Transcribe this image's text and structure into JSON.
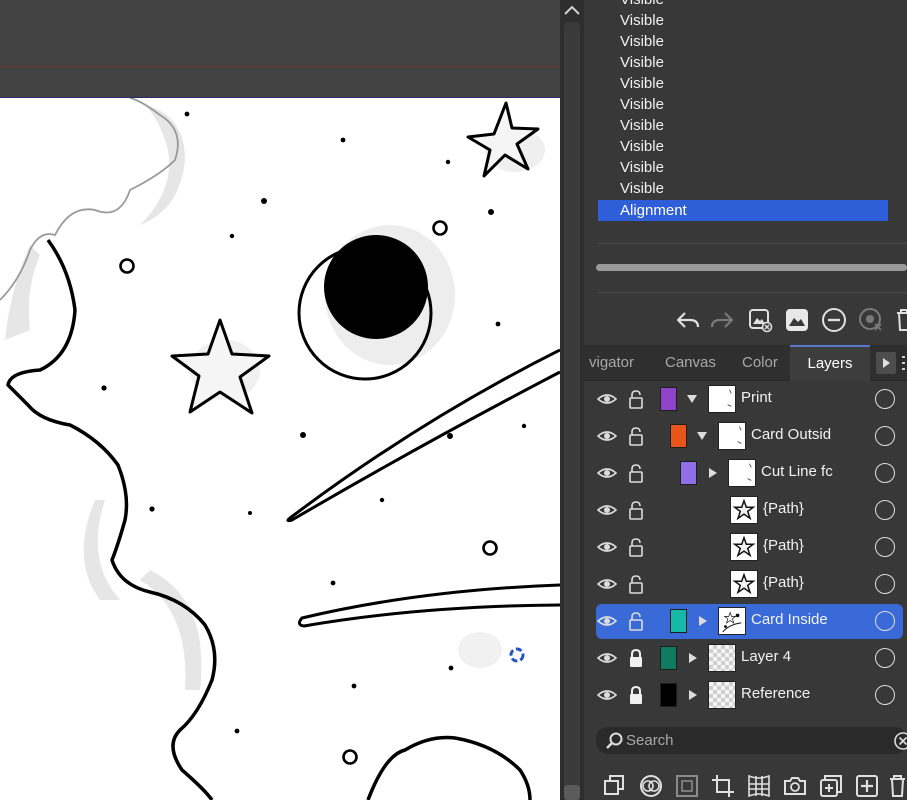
{
  "visibility_list": {
    "items": [
      "Visible",
      "Visible",
      "Visible",
      "Visible",
      "Visible",
      "Visible",
      "Visible",
      "Visible",
      "Visible",
      "Visible"
    ],
    "selected_item": "Alignment"
  },
  "panel_tabs": [
    {
      "label": "vigator",
      "active": false
    },
    {
      "label": "Canvas",
      "active": false
    },
    {
      "label": "Color",
      "active": false
    },
    {
      "label": "Layers",
      "active": true
    }
  ],
  "layers": [
    {
      "name": "Print",
      "swatch": "#8e44c9",
      "expander": "open",
      "thumb": "white",
      "locked": false,
      "selected": false
    },
    {
      "name": "Card Outsid",
      "swatch": "#e8541a",
      "expander": "open",
      "thumb": "white",
      "locked": false,
      "selected": false
    },
    {
      "name": "Cut Line fc",
      "swatch": "#8f6ee8",
      "expander": "closed",
      "thumb": "white",
      "locked": false,
      "selected": false
    },
    {
      "name": "{Path}",
      "swatch": null,
      "expander": null,
      "thumb": "star",
      "locked": false,
      "selected": false
    },
    {
      "name": "{Path}",
      "swatch": null,
      "expander": null,
      "thumb": "star",
      "locked": false,
      "selected": false
    },
    {
      "name": "{Path}",
      "swatch": null,
      "expander": null,
      "thumb": "star",
      "locked": false,
      "selected": false
    },
    {
      "name": "Card Inside",
      "swatch": "#17b8a6",
      "expander": "closed",
      "thumb": "art",
      "locked": false,
      "selected": true
    },
    {
      "name": "Layer 4",
      "swatch": "#0f7a5f",
      "expander": "closed",
      "thumb": "checker",
      "locked": true,
      "selected": false
    },
    {
      "name": "Reference",
      "swatch": "#000000",
      "expander": "closed",
      "thumb": "checker",
      "locked": true,
      "selected": false
    }
  ],
  "search": {
    "placeholder": "Search"
  },
  "toolbar_icons": [
    "undo-icon",
    "redo-icon",
    "add-image-layer-icon",
    "image-icon",
    "remove-icon",
    "target-icon",
    "trash-icon"
  ],
  "bottom_toolbar_icons": [
    "duplicate-layer-icon",
    "blend-mode-icon",
    "mask-icon",
    "crop-icon",
    "warp-icon",
    "camera-icon",
    "add-group-icon",
    "add-layer-icon",
    "delete-icon"
  ],
  "colors": {
    "accent": "#3a6ad8",
    "list_selection": "#2e5fd8"
  }
}
